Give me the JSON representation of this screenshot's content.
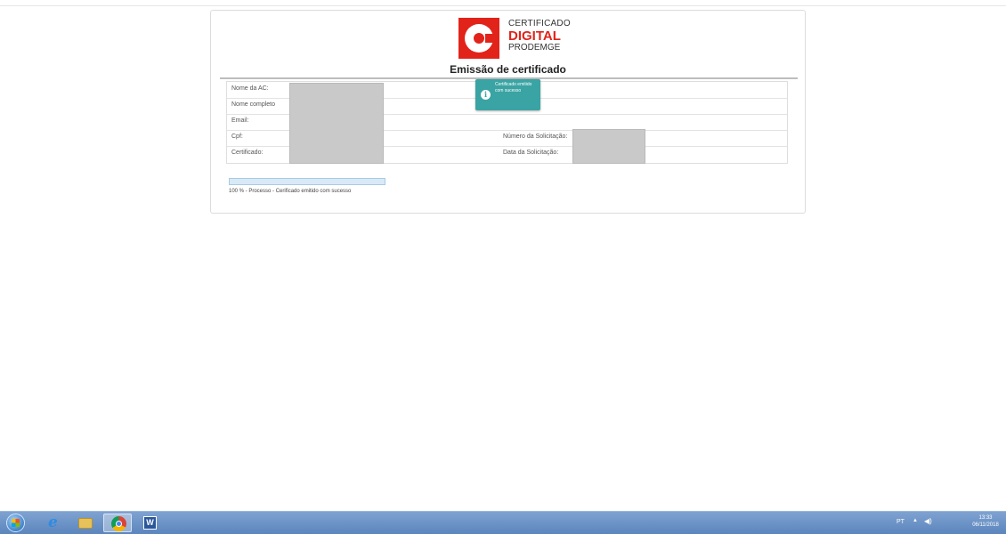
{
  "logo": {
    "line1": "CERTIFICADO",
    "line2": "DIGITAL",
    "line3": "PRODEMGE",
    "brand_color": "#e2231a"
  },
  "page": {
    "title": "Emissão de certificado"
  },
  "form": {
    "rows": [
      {
        "label": "Nome da AC:",
        "label2": ""
      },
      {
        "label": "Nome completo",
        "label2": ""
      },
      {
        "label": "Email:",
        "label2": ""
      },
      {
        "label": "Cpf:",
        "label2": "Número da Solicitação:"
      },
      {
        "label": "Certificado:",
        "label2": "Data da Solicitação:"
      }
    ]
  },
  "toast": {
    "message": "Certificado emitido com sucesso",
    "icon": "info-icon",
    "color": "#3aa3a3"
  },
  "progress": {
    "value": 1.0,
    "status": "100 % - Processo - Cerificado emitido com sucesso"
  },
  "taskbar": {
    "apps": [
      "start-button",
      "internet-explorer-icon",
      "file-explorer-icon",
      "chrome-icon",
      "word-icon"
    ],
    "language": "PT",
    "time": "13:33",
    "date": "06/11/2018"
  }
}
